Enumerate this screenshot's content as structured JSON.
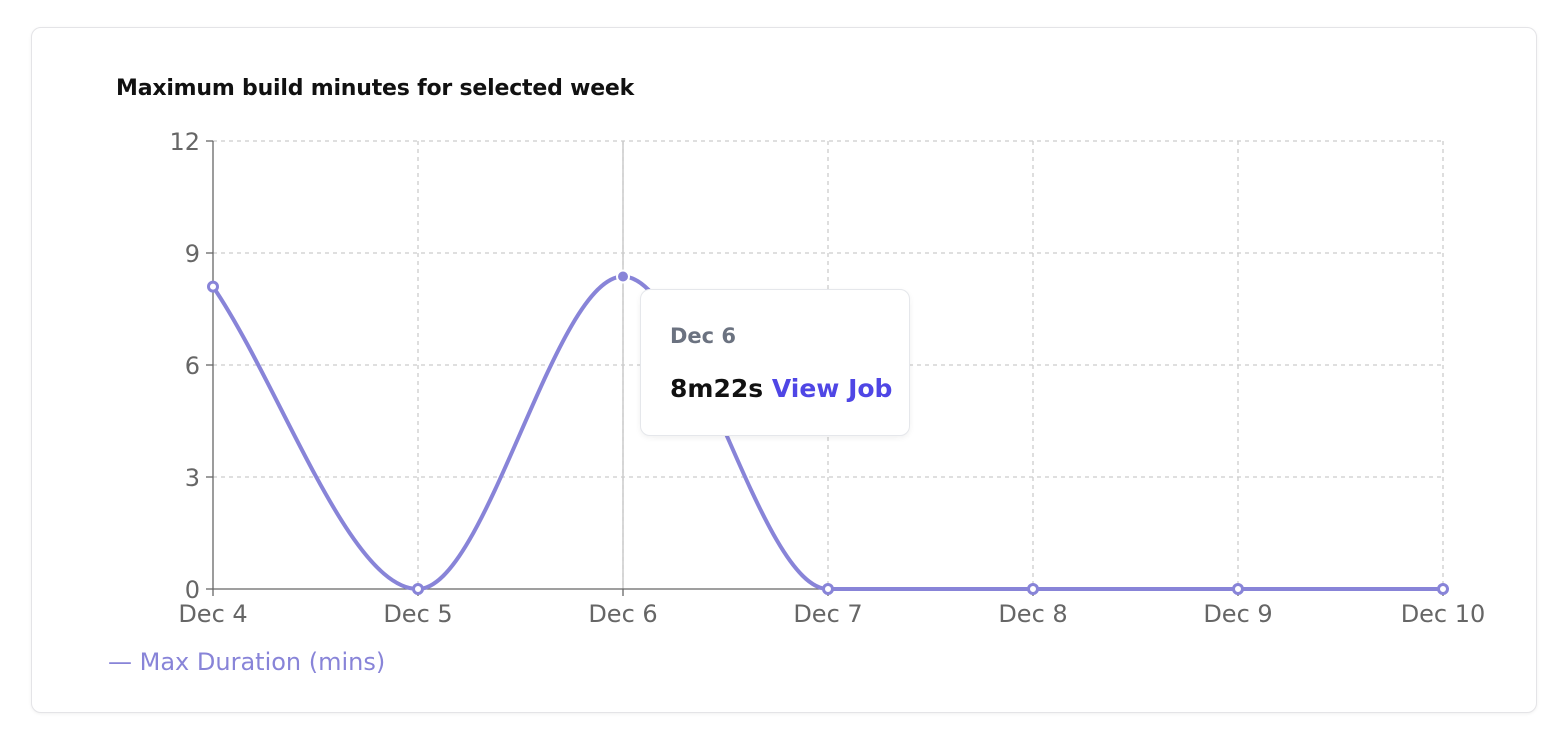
{
  "chart_data": {
    "type": "line",
    "title": "Maximum build minutes for selected week",
    "categories": [
      "Dec 4",
      "Dec 5",
      "Dec 6",
      "Dec 7",
      "Dec 8",
      "Dec 9",
      "Dec 10"
    ],
    "series": [
      {
        "name": "Max Duration (mins)",
        "values": [
          8.1,
          0,
          8.37,
          0,
          0,
          0,
          0
        ],
        "color": "#8884d8"
      }
    ],
    "yticks": [
      0,
      3,
      6,
      9,
      12
    ],
    "ylim": [
      0,
      12
    ],
    "grid": true,
    "legend": "bottom-left",
    "tooltip": {
      "category": "Dec 6",
      "value_text": "8m22s",
      "link_text": "View Job",
      "link_color": "#4f46e5"
    }
  }
}
